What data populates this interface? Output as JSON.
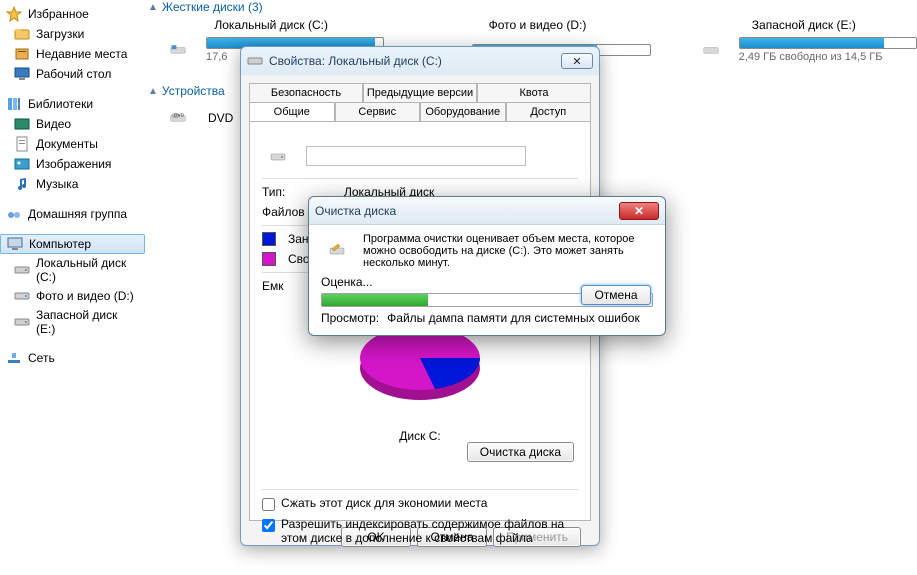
{
  "sidebar": {
    "favorites": {
      "label": "Избранное",
      "items": [
        {
          "label": "Загрузки"
        },
        {
          "label": "Недавние места"
        },
        {
          "label": "Рабочий стол"
        }
      ]
    },
    "libraries": {
      "label": "Библиотеки",
      "items": [
        {
          "label": "Видео"
        },
        {
          "label": "Документы"
        },
        {
          "label": "Изображения"
        },
        {
          "label": "Музыка"
        }
      ]
    },
    "homegroup": {
      "label": "Домашняя группа"
    },
    "computer": {
      "label": "Компьютер",
      "items": [
        {
          "label": "Локальный диск (C:)"
        },
        {
          "label": "Фото и видео (D:)"
        },
        {
          "label": "Запасной диск (E:)"
        }
      ]
    },
    "network": {
      "label": "Сеть"
    }
  },
  "main": {
    "hdd_header": "Жесткие диски (3)",
    "devices_header": "Устройства",
    "drives": [
      {
        "name": "Локальный диск (C:)",
        "sub": "17,6",
        "fillPct": 95
      },
      {
        "name": "Фото и видео (D:)",
        "sub": "",
        "fillPct": 70
      },
      {
        "name": "Запасной диск (E:)",
        "sub": "2,49 ГБ свободно из 14,5 ГБ",
        "fillPct": 82
      }
    ],
    "dvd": "DVD"
  },
  "props": {
    "title": "Свойства: Локальный диск (C:)",
    "tabs_row1": [
      "Безопасность",
      "Предыдущие версии",
      "Квота"
    ],
    "tabs_row2": [
      "Общие",
      "Сервис",
      "Оборудование",
      "Доступ"
    ],
    "type_label": "Тип:",
    "type_value": "Локальный диск",
    "fs_label": "Файлов",
    "used_label": "Зан",
    "free_label": "Сво",
    "cap_label": "Емк",
    "disk_caption": "Диск C:",
    "cleanup_btn": "Очистка диска",
    "compress": "Сжать этот диск для экономии места",
    "index": "Разрешить индексировать содержимое файлов на этом диске в дополнение к свойствам файла",
    "ok": "OK",
    "cancel": "Отмена",
    "apply": "Применить"
  },
  "cleanup": {
    "title": "Очистка диска",
    "message": "Программа очистки оценивает объем места, которое можно освободить на диске  (C:). Это может занять несколько минут.",
    "eval": "Оценка...",
    "scan_label": "Просмотр:",
    "scan_value": "Файлы дампа памяти для системных ошибок",
    "cancel": "Отмена"
  },
  "colors": {
    "used": "#0016d8",
    "free": "#d516c8"
  }
}
